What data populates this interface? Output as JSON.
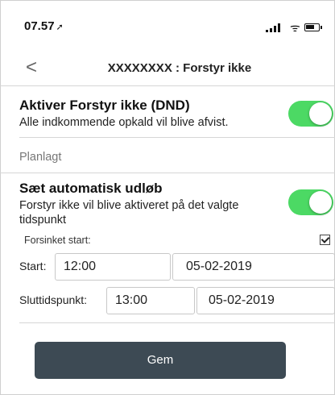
{
  "status_bar": {
    "time": "07.57",
    "location_glyph": "➚",
    "icons": [
      "signal-icon",
      "wifi-icon",
      "battery-icon"
    ]
  },
  "nav": {
    "back_glyph": "<",
    "title": "XXXXXXXX : Forstyr ikke"
  },
  "dnd": {
    "title": "Aktiver Forstyr ikke (DND)",
    "subtitle": "Alle indkommende opkald vil blive afvist.",
    "enabled": true
  },
  "section_label": "Planlagt",
  "auto_expire": {
    "title": "Sæt automatisk udløb",
    "subtitle": "Forstyr ikke vil blive aktiveret på det valgte tidspunkt",
    "enabled": true
  },
  "delayed_start": {
    "label": "Forsinket start:",
    "checked": true
  },
  "start": {
    "label": "Start:",
    "time": "12:00",
    "date": "05-02-2019"
  },
  "end": {
    "label": "Sluttidspunkt:",
    "time": "13:00",
    "date": "05-02-2019"
  },
  "save_label": "Gem",
  "colors": {
    "toggle_on": "#4cd964",
    "button": "#3d4a54"
  }
}
